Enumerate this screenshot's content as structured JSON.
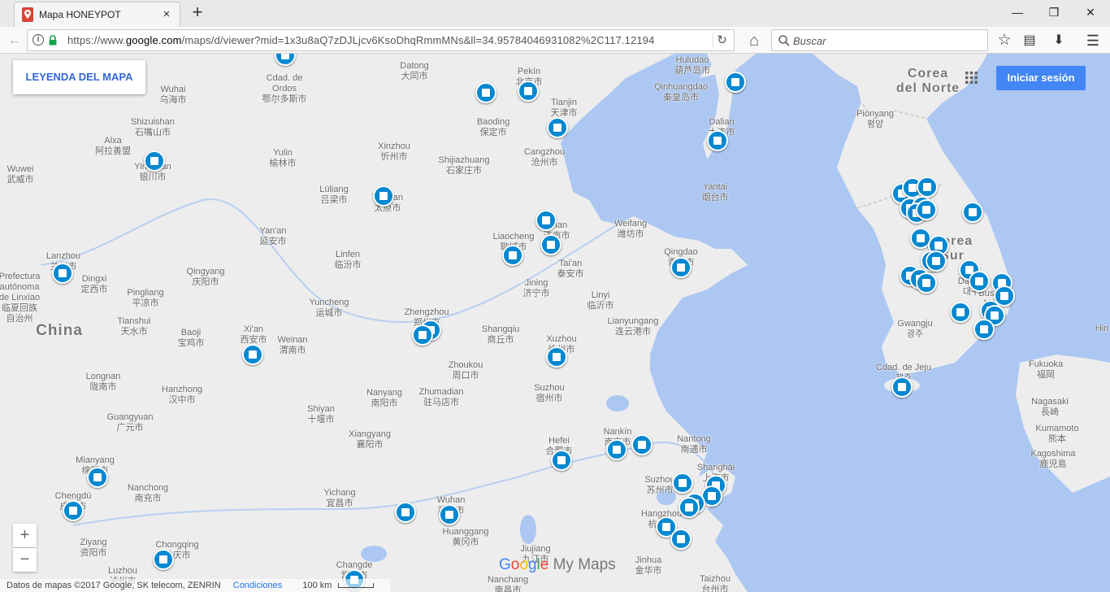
{
  "browser": {
    "tab_title": "Mapa HONEYPOT",
    "tab_close_icon": "×",
    "new_tab_icon": "+",
    "window_controls": {
      "minimize": "—",
      "maximize": "❐",
      "close": "✕"
    },
    "url_prefix": "https://www.",
    "url_domain": "google.com",
    "url_rest": "/maps/d/viewer?mid=1x3u8aQ7zDJLjcv6KsoDhqRmmMNs&ll=34.95784046931082%2C117.12194",
    "search_placeholder": "Buscar",
    "toolbar_icons": {
      "back": "←",
      "reload": "↻",
      "home": "⌂",
      "bookmark": "☆",
      "reading_list": "▤",
      "download": "⬇",
      "menu": "☰"
    }
  },
  "map_ui": {
    "legend_button": "LEYENDA DEL MAPA",
    "signin_button": "Iniciar sesión",
    "zoom_in": "+",
    "zoom_out": "−",
    "footer_copyright": "Datos de mapas ©2017 Google, SK telecom, ZENRIN",
    "footer_terms": "Condiciones",
    "footer_scale": "100 km",
    "logo_google": [
      "G",
      "o",
      "o",
      "g",
      "l",
      "e"
    ],
    "logo_google_colors": [
      "#4285f4",
      "#ea4335",
      "#fbbc05",
      "#4285f4",
      "#34a853",
      "#ea4335"
    ],
    "logo_mymaps": " My Maps"
  },
  "colors": {
    "marker": "#0288d1",
    "water": "#acc7f2",
    "land": "#ededed",
    "signin": "#4285f4",
    "legend_text": "#3367d6"
  },
  "country_labels": [
    {
      "text": "China"
    },
    {
      "text": "Corea\ndel Norte"
    },
    {
      "text": "Corea\nSur"
    }
  ],
  "city_labels": [
    {
      "text": "Cdad. de\nOrdos\n鄂尔多斯市"
    },
    {
      "text": "Datong\n大同市"
    },
    {
      "text": "Pekín\n北京市"
    },
    {
      "text": "Huludao\n葫芦岛市"
    },
    {
      "text": "Qinhuangdao\n秦皇岛市"
    },
    {
      "text": "Wuhai\n乌海市"
    },
    {
      "text": "Tianjin\n天津市"
    },
    {
      "text": "Shizuishan\n石嘴山市"
    },
    {
      "text": "Baoding\n保定市"
    },
    {
      "text": "Dalian\n大连市"
    },
    {
      "text": "Pionyang\n평양"
    },
    {
      "text": "Alxa\n阿拉善盟"
    },
    {
      "text": "Xinzhou\n忻州市"
    },
    {
      "text": "Cangzhou\n沧州市"
    },
    {
      "text": "Yinchuan\n银川市"
    },
    {
      "text": "Yulin\n榆林市"
    },
    {
      "text": "Shijiazhuang\n石家庄市"
    },
    {
      "text": "Wuwei\n武威市"
    },
    {
      "text": "Lüliang\n吕梁市"
    },
    {
      "text": "Taiyuan\n太原市"
    },
    {
      "text": "Yantai\n烟台市"
    },
    {
      "text": "Jinan\n济南市"
    },
    {
      "text": "Weifang\n潍坊市"
    },
    {
      "text": "Yan'an\n延安市"
    },
    {
      "text": "Liaocheng\n聊城市"
    },
    {
      "text": "Qingdao\n青岛市"
    },
    {
      "text": "Lanzhou\n兰州市"
    },
    {
      "text": "Linfen\n临汾市"
    },
    {
      "text": "Tai'an\n泰安市"
    },
    {
      "text": "Dingxi\n定西市"
    },
    {
      "text": "Qingyang\n庆阳市"
    },
    {
      "text": "Prefectura\nautónoma\nde Linxiao\n临夏回族\n自治州"
    },
    {
      "text": "Jining\n济宁市"
    },
    {
      "text": "Pingliang\n平凉市"
    },
    {
      "text": "Linyi\n临沂市"
    },
    {
      "text": "Yuncheng\n运城市"
    },
    {
      "text": "Zhengzhou\n郑州市"
    },
    {
      "text": "Lianyungang\n连云港市"
    },
    {
      "text": "Tianshui\n天水市"
    },
    {
      "text": "Baoji\n宝鸡市"
    },
    {
      "text": "Xi'an\n西安市"
    },
    {
      "text": "Weinan\n渭南市"
    },
    {
      "text": "Shangqiu\n商丘市"
    },
    {
      "text": "Xuzhou\n徐州市"
    },
    {
      "text": "Gwangju\n광주"
    },
    {
      "text": "Daegu\n대구"
    },
    {
      "text": "Busan\n부산"
    },
    {
      "text": "Zhoukou\n周口市"
    },
    {
      "text": "Cdad. de Jeju\n제주"
    },
    {
      "text": "Fukuoka\n福岡"
    },
    {
      "text": "Longnan\n陇南市"
    },
    {
      "text": "Suzhou\n宿州市"
    },
    {
      "text": "Hanzhong\n汉中市"
    },
    {
      "text": "Nanyang\n南阳市"
    },
    {
      "text": "Zhumadian\n驻马店市"
    },
    {
      "text": "Shiyan\n十堰市"
    },
    {
      "text": "Nagasaki\n長崎"
    },
    {
      "text": "Guangyuan\n广元市"
    },
    {
      "text": "Kumamoto\n熊本"
    },
    {
      "text": "Nankín\n南京市"
    },
    {
      "text": "Nantong\n南通市"
    },
    {
      "text": "Xiangyang\n襄阳市"
    },
    {
      "text": "Hefei\n合肥市"
    },
    {
      "text": "Kagoshima\n鹿児島"
    },
    {
      "text": "Mianyang\n绵阳市"
    },
    {
      "text": "Shanghái\n上海市"
    },
    {
      "text": "Suzhou\n苏州市"
    },
    {
      "text": "Chengdú\n成都市"
    },
    {
      "text": "Nanchong\n南充市"
    },
    {
      "text": "Yichang\n宜昌市"
    },
    {
      "text": "Wuhan\n武汉市"
    },
    {
      "text": "Hangzhou\n杭州市"
    },
    {
      "text": "Huanggang\n黄冈市"
    },
    {
      "text": "Ziyang\n资阳市"
    },
    {
      "text": "Chongqing\n重庆市"
    },
    {
      "text": "Jiujiang\n九江市"
    },
    {
      "text": "Jinhua\n金华市"
    },
    {
      "text": "Luzhou\n泸州市"
    },
    {
      "text": "Changde\n常德市"
    },
    {
      "text": "Nanchang\n南昌市"
    },
    {
      "text": "Taizhou\n台州市"
    },
    {
      "text": "Hin"
    }
  ]
}
